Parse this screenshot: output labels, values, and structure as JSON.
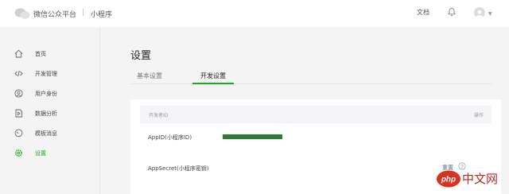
{
  "topbar": {
    "brand": "微信公众平台",
    "separator": "|",
    "product": "小程序",
    "docs_label": "文档"
  },
  "sidebar": {
    "items": [
      {
        "label": "首页",
        "icon": "home-icon"
      },
      {
        "label": "开发管理",
        "icon": "code-icon"
      },
      {
        "label": "用户身份",
        "icon": "user-circle-icon"
      },
      {
        "label": "数据分析",
        "icon": "chart-doc-icon"
      },
      {
        "label": "模板消息",
        "icon": "message-icon"
      },
      {
        "label": "设置",
        "icon": "gear-icon",
        "active": true
      }
    ]
  },
  "main": {
    "title": "设置",
    "tabs": [
      {
        "label": "基本设置",
        "active": false
      },
      {
        "label": "开发设置",
        "active": true
      }
    ],
    "card": {
      "header_title": "开发者ID",
      "header_action": "操作",
      "rows": [
        {
          "label": "AppID(小程序ID)"
        },
        {
          "label": "AppSecret(小程序密钥)",
          "action": "重置"
        }
      ]
    }
  },
  "watermark": "php中文网",
  "colors": {
    "accent": "#1aad19",
    "redaction": "#2a7d32",
    "watermark_red": "#d9321f"
  }
}
